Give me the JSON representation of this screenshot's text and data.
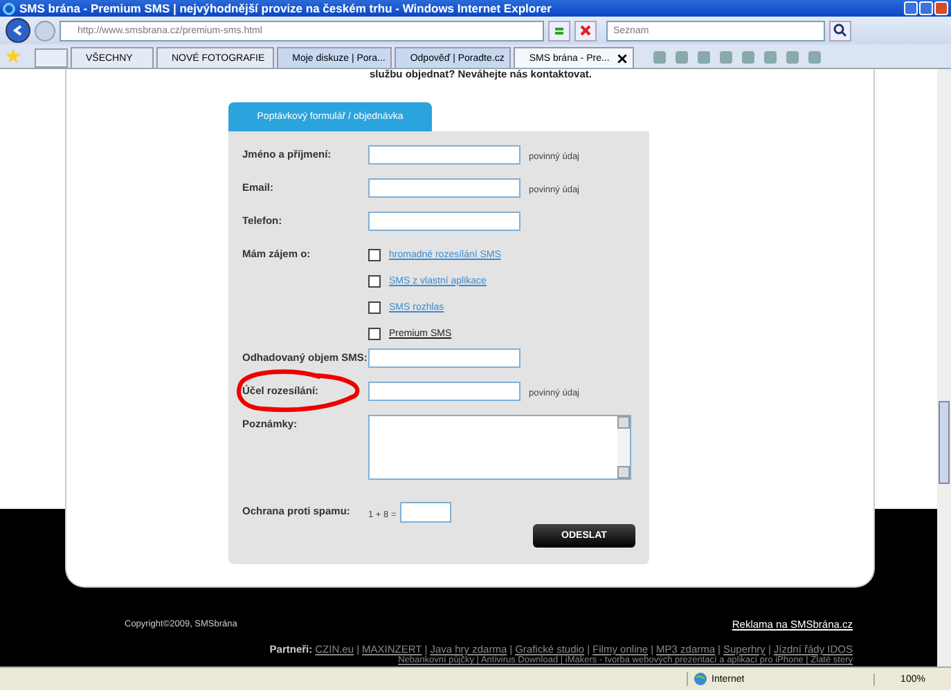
{
  "window": {
    "title": "SMS brána - Premium SMS | nejvýhodnější provize na českém trhu - Windows Internet Explorer"
  },
  "address_bar": {
    "url": "http://www.smsbrana.cz/premium-sms.html"
  },
  "search": {
    "placeholder": "Seznam"
  },
  "favorites": [
    "VŠECHNY",
    "NOVÉ FOTOGRAFIE"
  ],
  "tabs": [
    {
      "label": "Moje diskuze | Pora...",
      "selected": false
    },
    {
      "label": "Odpověď | Poradte.cz",
      "selected": false
    },
    {
      "label": "SMS brána - Pre...",
      "selected": true
    }
  ],
  "page": {
    "intro_text": "službu objednat? Neváhejte nás kontaktovat.",
    "form": {
      "tab_label": "Poptávkový formulář / objednávka",
      "fields": [
        {
          "kind": "text",
          "label": "Jméno a příjmení:",
          "note": "povinný údaj"
        },
        {
          "kind": "text",
          "label": "Email:",
          "note": "povinný údaj"
        },
        {
          "kind": "text",
          "label": "Telefon:"
        },
        {
          "kind": "checkboxes",
          "label": "Mám zájem o:",
          "options": [
            {
              "label": "hromadné rozesílání SMS",
              "checked": false,
              "visited": false
            },
            {
              "label": "SMS z vlastní aplikace",
              "checked": false,
              "visited": false
            },
            {
              "label": "SMS rozhlas",
              "checked": false,
              "visited": false
            },
            {
              "label": "Premium SMS",
              "checked": false,
              "visited": true
            }
          ]
        },
        {
          "kind": "text",
          "label": "Odhadovaný objem SMS:"
        },
        {
          "kind": "text",
          "label": "Účel rozesílání:",
          "note": "povinný údaj",
          "circled": true
        },
        {
          "kind": "textarea",
          "label": "Poznámky:"
        },
        {
          "kind": "captcha",
          "label": "Ochrana proti spamu:",
          "question": "1 + 8 ="
        }
      ],
      "submit": "ODESLAT"
    },
    "footer": {
      "copyright": "Copyright©2009, SMSbrána",
      "ad_link": "Reklama na SMSbrána.cz",
      "partners_label": "Partneři:",
      "partners_separator": "|",
      "partners": [
        "CZIN.eu",
        "MAXINZERT",
        "Java hry zdarma",
        "Grafické studio",
        "Filmy online",
        "MP3 zdarma",
        "Superhry",
        "Jízdní řády IDOS"
      ],
      "partners_line_2": "Nebankovní půjčky | Antivirus Download | iMakers - tvorba webových prezentací a aplikací pro iPhone | Zlaté stery"
    }
  },
  "status_bar": {
    "zone": "Internet",
    "zoom": "100%"
  }
}
